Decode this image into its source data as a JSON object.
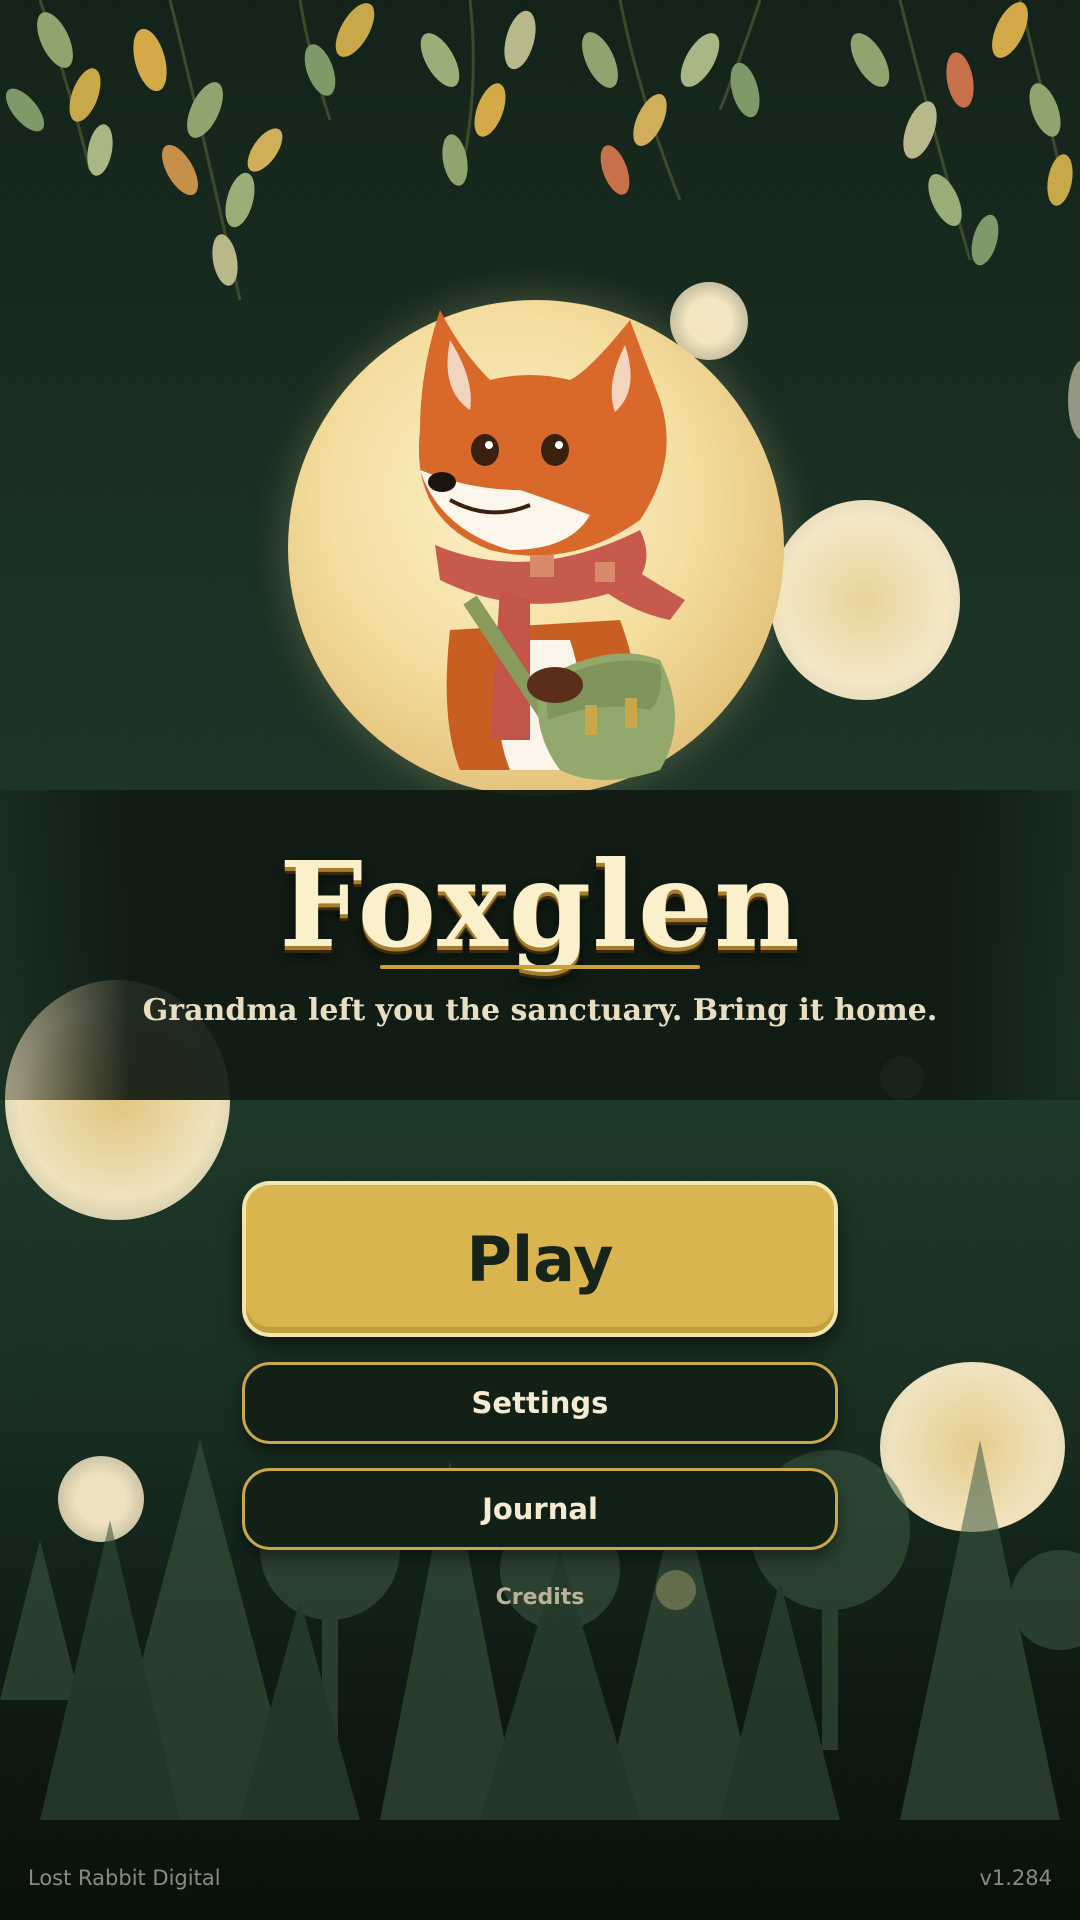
{
  "game": {
    "title": "Foxglen",
    "tagline": "Grandma left you the sanctuary. Bring it home."
  },
  "menu": {
    "play_label": "Play",
    "settings_label": "Settings",
    "journal_label": "Journal",
    "credits_label": "Credits"
  },
  "footer": {
    "studio": "Lost Rabbit Digital",
    "version": "v1.284"
  },
  "art": {
    "hero": "fox-with-scarf-and-satchel",
    "backdrop": "full-moon",
    "top_decoration": "hanging-leaves",
    "bottom_decoration": "forest-silhouette"
  },
  "colors": {
    "background": "#1f3a2a",
    "accent_gold": "#d9b550",
    "title_cream": "#fbf0cc",
    "button_dark": "#132016"
  }
}
